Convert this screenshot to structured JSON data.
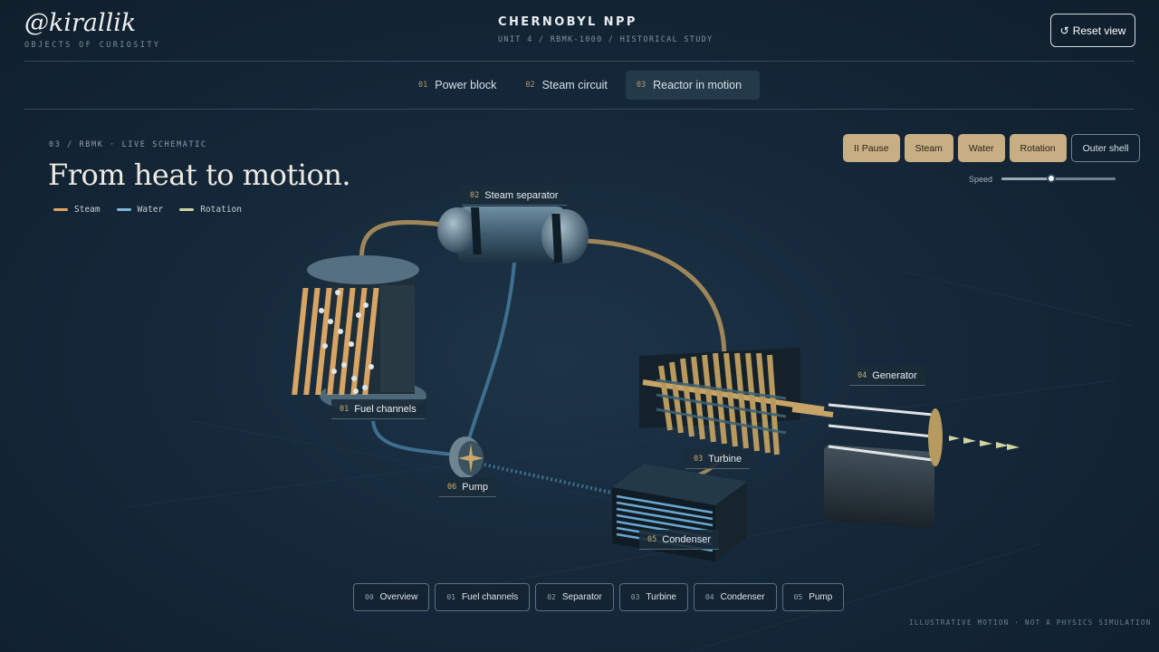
{
  "brand": {
    "name": "@kirallik",
    "tagline": "OBJECTS OF CURIOSITY"
  },
  "header": {
    "title": "CHERNOBYL NPP",
    "subtitle": "UNIT 4 / RBMK-1000 / HISTORICAL STUDY",
    "reset_icon": "↺",
    "reset_label": "Reset view"
  },
  "tabs": [
    {
      "num": "01",
      "label": "Power block",
      "active": false
    },
    {
      "num": "02",
      "label": "Steam circuit",
      "active": false
    },
    {
      "num": "03",
      "label": "Reactor in motion",
      "active": true
    }
  ],
  "section": {
    "kicker": "03 / RBMK · LIVE SCHEMATIC",
    "heading": "From heat to motion."
  },
  "legend": [
    {
      "label": "Steam",
      "color": "#e0a764"
    },
    {
      "label": "Water",
      "color": "#7fb6dc"
    },
    {
      "label": "Rotation",
      "color": "#cfd3a0"
    }
  ],
  "controls": {
    "pause_icon": "II",
    "pause_label": "Pause",
    "steam_label": "Steam",
    "water_label": "Water",
    "rotation_label": "Rotation",
    "outer_shell_label": "Outer shell",
    "speed_label": "Speed",
    "speed_value": 0.44
  },
  "labels": {
    "fuel_channels": {
      "num": "01",
      "text": "Fuel channels"
    },
    "steam_separator": {
      "num": "02",
      "text": "Steam separator"
    },
    "turbine": {
      "num": "03",
      "text": "Turbine"
    },
    "generator": {
      "num": "04",
      "text": "Generator"
    },
    "condenser": {
      "num": "05",
      "text": "Condenser"
    },
    "pump": {
      "num": "06",
      "text": "Pump"
    }
  },
  "bottom_nav": [
    {
      "num": "00",
      "label": "Overview"
    },
    {
      "num": "01",
      "label": "Fuel channels"
    },
    {
      "num": "02",
      "label": "Separator"
    },
    {
      "num": "03",
      "label": "Turbine"
    },
    {
      "num": "04",
      "label": "Condenser"
    },
    {
      "num": "05",
      "label": "Pump"
    }
  ],
  "footnote": "ILLUSTRATIVE MOTION · NOT A PHYSICS SIMULATION",
  "colors": {
    "accent": "#c8ae83",
    "steam": "#e0a764",
    "water": "#7fb6dc",
    "rotation": "#cfd3a0",
    "background": "#15283a"
  }
}
